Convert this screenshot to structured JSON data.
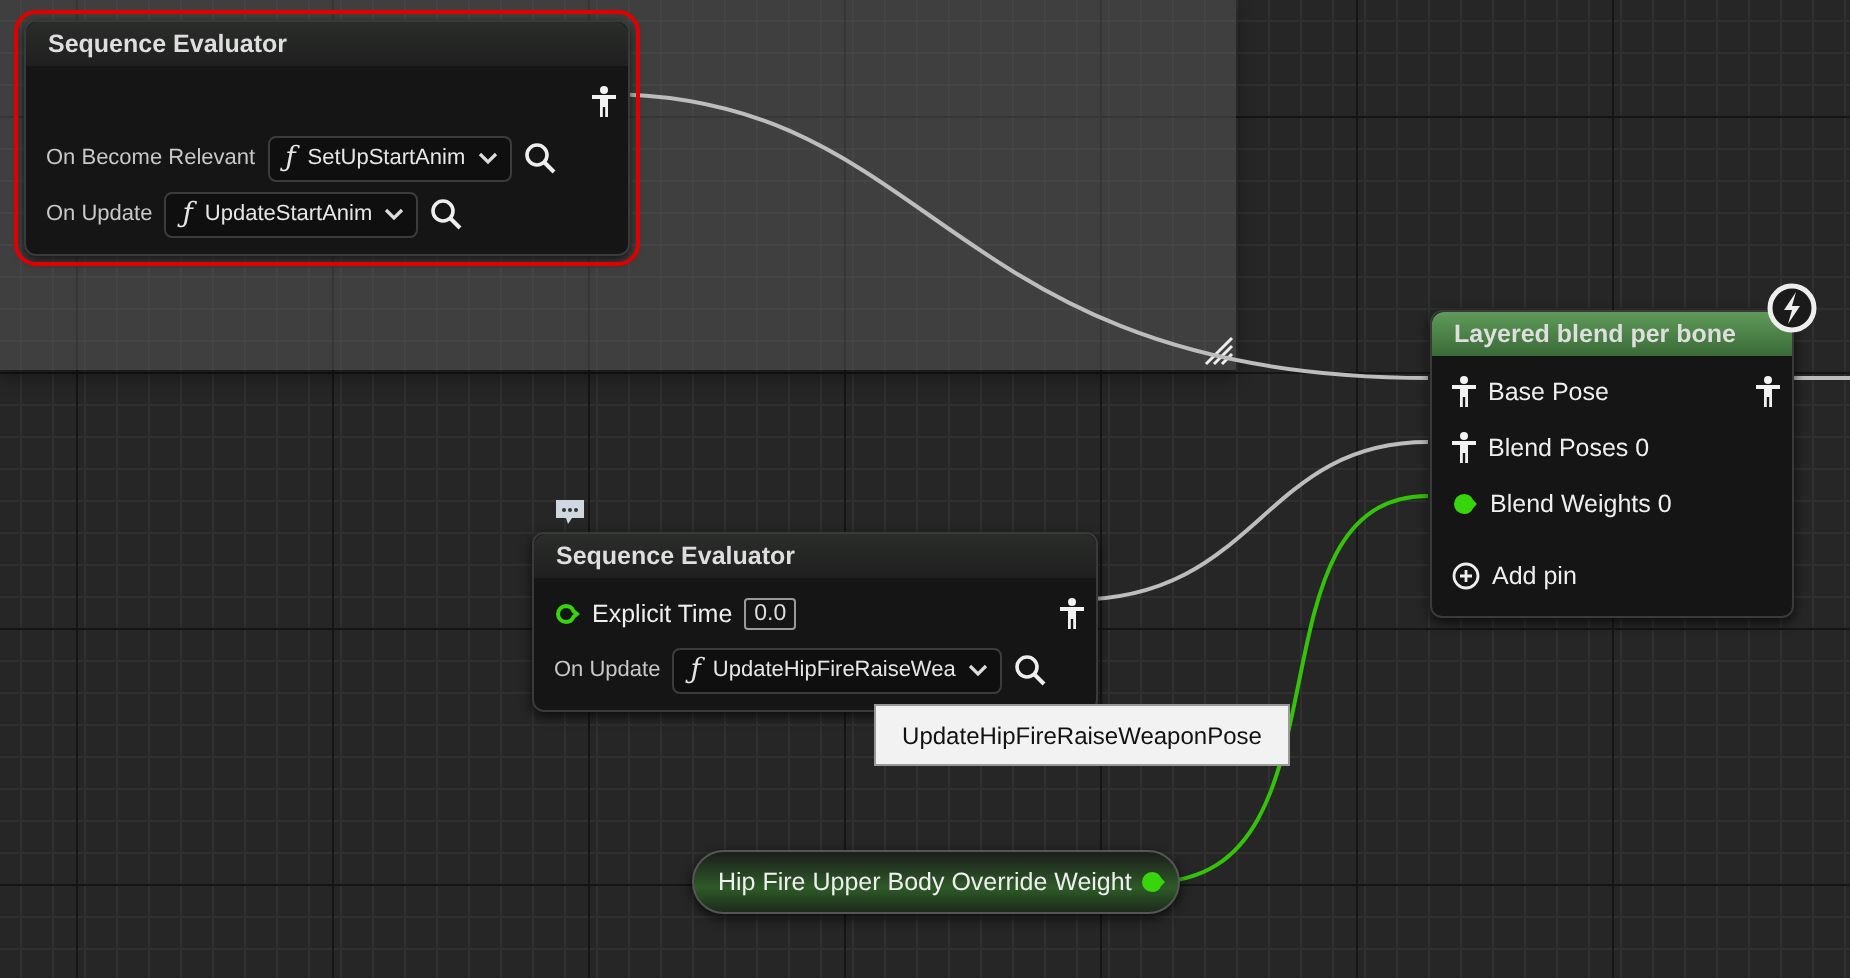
{
  "nodes": [
    {
      "kind": "sequence_evaluator",
      "title": "Sequence Evaluator",
      "selected": true,
      "rows": [
        {
          "kind": "pins",
          "output": {
            "kind": "pose"
          }
        },
        {
          "kind": "function",
          "label": "On Become Relevant",
          "icon": "ƒ",
          "function": "SetUpStartAnim"
        },
        {
          "kind": "function",
          "label": "On Update",
          "icon": "ƒ",
          "function": "UpdateStartAnim"
        }
      ]
    },
    {
      "kind": "blend",
      "title": "Layered blend per bone",
      "selected": false,
      "fast_path": true,
      "rows": [
        {
          "kind": "pins",
          "input": {
            "kind": "pose",
            "label": "Base Pose"
          },
          "output": {
            "kind": "pose"
          }
        },
        {
          "kind": "pins",
          "input": {
            "kind": "pose",
            "label": "Blend Poses 0"
          }
        },
        {
          "kind": "pins",
          "input": {
            "kind": "float",
            "label": "Blend Weights 0",
            "connected": true
          }
        },
        {
          "kind": "add_pin",
          "label": "Add pin"
        }
      ]
    },
    {
      "kind": "sequence_evaluator",
      "title": "Sequence Evaluator",
      "selected": false,
      "comment_bubble": true,
      "rows": [
        {
          "kind": "pins",
          "input": {
            "kind": "float",
            "label": "Explicit Time",
            "value": "0.0",
            "connected": false
          },
          "output": {
            "kind": "pose"
          }
        },
        {
          "kind": "function",
          "label": "On Update",
          "icon": "ƒ",
          "function": "UpdateHipFireRaiseWea"
        }
      ]
    },
    {
      "kind": "variable",
      "title": "Hip Fire Upper Body Override Weight",
      "selected": false,
      "connected": true
    }
  ],
  "tooltip": "UpdateHipFireRaiseWeaponPose"
}
